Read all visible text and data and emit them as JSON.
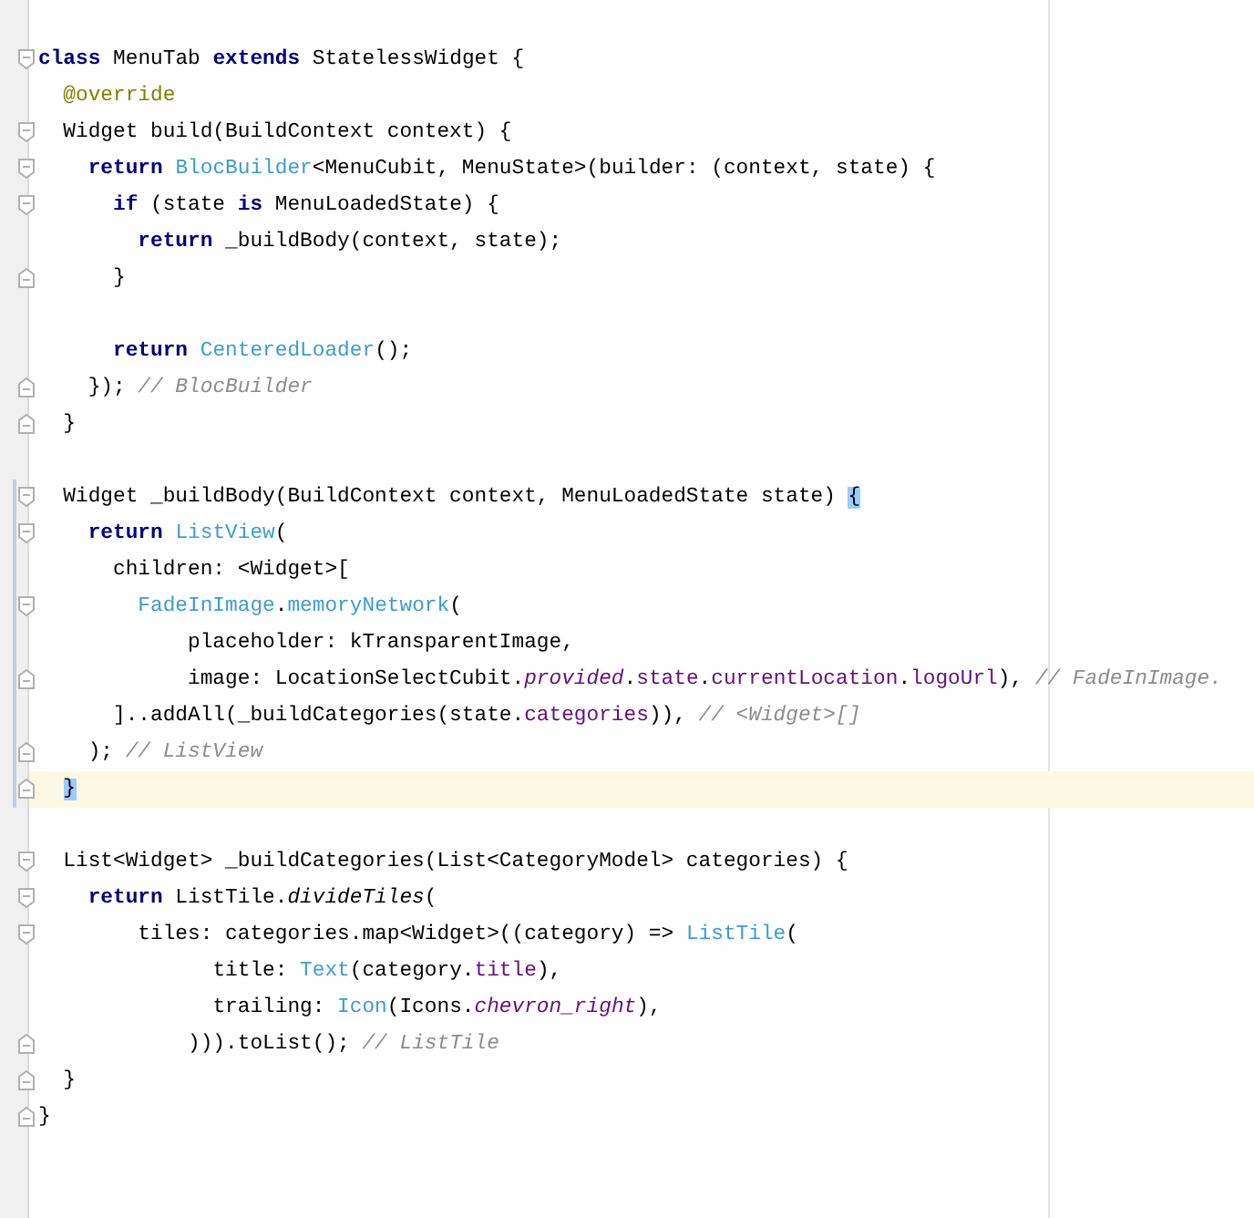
{
  "editor": {
    "lines": [
      {
        "fold_start": true,
        "fold_end": false,
        "changed": false,
        "current": false,
        "tokens": [
          {
            "text": "class",
            "kind": "keyword"
          },
          {
            "text": " MenuTab ",
            "kind": "plain"
          },
          {
            "text": "extends",
            "kind": "keyword"
          },
          {
            "text": " StatelessWidget {",
            "kind": "plain"
          }
        ]
      },
      {
        "fold_start": false,
        "fold_end": false,
        "changed": false,
        "current": false,
        "tokens": [
          {
            "text": "  @override",
            "kind": "annotation"
          }
        ]
      },
      {
        "fold_start": true,
        "fold_end": false,
        "changed": false,
        "current": false,
        "tokens": [
          {
            "text": "  Widget build(BuildContext context) {",
            "kind": "plain"
          }
        ]
      },
      {
        "fold_start": true,
        "fold_end": false,
        "changed": false,
        "current": false,
        "tokens": [
          {
            "text": "    return ",
            "kind": "keyword"
          },
          {
            "text": "BlocBuilder",
            "kind": "class"
          },
          {
            "text": "<MenuCubit, MenuState>(builder: (context, state) {",
            "kind": "plain"
          }
        ]
      },
      {
        "fold_start": true,
        "fold_end": false,
        "changed": false,
        "current": false,
        "tokens": [
          {
            "text": "      if",
            "kind": "keyword"
          },
          {
            "text": " (state ",
            "kind": "plain"
          },
          {
            "text": "is",
            "kind": "keyword"
          },
          {
            "text": " MenuLoadedState) {",
            "kind": "plain"
          }
        ]
      },
      {
        "fold_start": false,
        "fold_end": false,
        "changed": false,
        "current": false,
        "tokens": [
          {
            "text": "        return",
            "kind": "keyword"
          },
          {
            "text": " _buildBody(context, state);",
            "kind": "plain"
          }
        ]
      },
      {
        "fold_start": false,
        "fold_end": true,
        "changed": false,
        "current": false,
        "tokens": [
          {
            "text": "      }",
            "kind": "plain"
          }
        ]
      },
      {
        "blank": true
      },
      {
        "fold_start": false,
        "fold_end": false,
        "changed": false,
        "current": false,
        "tokens": [
          {
            "text": "      return ",
            "kind": "keyword"
          },
          {
            "text": "CenteredLoader",
            "kind": "class"
          },
          {
            "text": "();",
            "kind": "plain"
          }
        ]
      },
      {
        "fold_start": false,
        "fold_end": true,
        "changed": false,
        "current": false,
        "tokens": [
          {
            "text": "    });",
            "kind": "plain"
          },
          {
            "text": " // BlocBuilder",
            "kind": "comment"
          }
        ]
      },
      {
        "fold_start": false,
        "fold_end": true,
        "changed": false,
        "current": false,
        "tokens": [
          {
            "text": "  }",
            "kind": "plain"
          }
        ]
      },
      {
        "blank": true
      },
      {
        "fold_start": true,
        "fold_end": false,
        "changed": true,
        "current": false,
        "tokens": [
          {
            "text": "  Widget _buildBody(BuildContext context, MenuLoadedState state) ",
            "kind": "plain"
          },
          {
            "text": "{",
            "kind": "match"
          }
        ]
      },
      {
        "fold_start": true,
        "fold_end": false,
        "changed": true,
        "current": false,
        "tokens": [
          {
            "text": "    return ",
            "kind": "keyword"
          },
          {
            "text": "ListView",
            "kind": "class"
          },
          {
            "text": "(",
            "kind": "plain"
          }
        ]
      },
      {
        "fold_start": false,
        "fold_end": false,
        "changed": true,
        "current": false,
        "tokens": [
          {
            "text": "      children: <Widget>[",
            "kind": "plain"
          }
        ]
      },
      {
        "fold_start": true,
        "fold_end": false,
        "changed": true,
        "current": false,
        "tokens": [
          {
            "text": "        FadeInImage",
            "kind": "class"
          },
          {
            "text": ".",
            "kind": "plain"
          },
          {
            "text": "memoryNetwork",
            "kind": "class"
          },
          {
            "text": "(",
            "kind": "plain"
          }
        ]
      },
      {
        "fold_start": false,
        "fold_end": false,
        "changed": true,
        "current": false,
        "tokens": [
          {
            "text": "            placeholder: kTransparentImage,",
            "kind": "plain"
          }
        ]
      },
      {
        "fold_start": false,
        "fold_end": true,
        "changed": true,
        "current": false,
        "tokens": [
          {
            "text": "            image: LocationSelectCubit.",
            "kind": "plain"
          },
          {
            "text": "provided",
            "kind": "italic_field"
          },
          {
            "text": ".",
            "kind": "plain"
          },
          {
            "text": "state",
            "kind": "field"
          },
          {
            "text": ".",
            "kind": "plain"
          },
          {
            "text": "currentLocation",
            "kind": "field"
          },
          {
            "text": ".",
            "kind": "plain"
          },
          {
            "text": "logoUrl",
            "kind": "field"
          },
          {
            "text": "),",
            "kind": "plain"
          },
          {
            "text": " // FadeInImage.",
            "kind": "comment"
          }
        ]
      },
      {
        "fold_start": false,
        "fold_end": false,
        "changed": true,
        "current": false,
        "tokens": [
          {
            "text": "      ]..addAll(_buildCategories(state.",
            "kind": "plain"
          },
          {
            "text": "categories",
            "kind": "field"
          },
          {
            "text": ")),",
            "kind": "plain"
          },
          {
            "text": " // <Widget>[]",
            "kind": "comment"
          }
        ]
      },
      {
        "fold_start": false,
        "fold_end": true,
        "changed": true,
        "current": false,
        "tokens": [
          {
            "text": "    );",
            "kind": "plain"
          },
          {
            "text": " // ListView",
            "kind": "comment"
          }
        ]
      },
      {
        "fold_start": false,
        "fold_end": true,
        "changed": true,
        "current": true,
        "tokens": [
          {
            "text": "  }",
            "kind": "match"
          }
        ]
      },
      {
        "blank": true
      },
      {
        "fold_start": true,
        "fold_end": false,
        "changed": false,
        "current": false,
        "tokens": [
          {
            "text": "  List<Widget> _buildCategories(List<CategoryModel> categories) {",
            "kind": "plain"
          }
        ]
      },
      {
        "fold_start": true,
        "fold_end": false,
        "changed": false,
        "current": false,
        "tokens": [
          {
            "text": "    return",
            "kind": "keyword"
          },
          {
            "text": " ListTile.",
            "kind": "plain"
          },
          {
            "text": "divideTiles",
            "kind": "italic"
          },
          {
            "text": "(",
            "kind": "plain"
          }
        ]
      },
      {
        "fold_start": true,
        "fold_end": false,
        "changed": false,
        "current": false,
        "tokens": [
          {
            "text": "        tiles: categories.map<Widget>((category) => ",
            "kind": "plain"
          },
          {
            "text": "ListTile",
            "kind": "class"
          },
          {
            "text": "(",
            "kind": "plain"
          }
        ]
      },
      {
        "fold_start": false,
        "fold_end": false,
        "changed": false,
        "current": false,
        "tokens": [
          {
            "text": "              title: ",
            "kind": "plain"
          },
          {
            "text": "Text",
            "kind": "class"
          },
          {
            "text": "(category.",
            "kind": "plain"
          },
          {
            "text": "title",
            "kind": "field"
          },
          {
            "text": "),",
            "kind": "plain"
          }
        ]
      },
      {
        "fold_start": false,
        "fold_end": false,
        "changed": false,
        "current": false,
        "tokens": [
          {
            "text": "              trailing: ",
            "kind": "plain"
          },
          {
            "text": "Icon",
            "kind": "class"
          },
          {
            "text": "(Icons.",
            "kind": "plain"
          },
          {
            "text": "chevron_right",
            "kind": "italic_field"
          },
          {
            "text": "),",
            "kind": "plain"
          }
        ]
      },
      {
        "fold_start": false,
        "fold_end": true,
        "changed": false,
        "current": false,
        "tokens": [
          {
            "text": "            ))).toList();",
            "kind": "plain"
          },
          {
            "text": " // ListTile",
            "kind": "comment"
          }
        ]
      },
      {
        "fold_start": false,
        "fold_end": true,
        "changed": false,
        "current": false,
        "tokens": [
          {
            "text": "  }",
            "kind": "plain"
          }
        ]
      },
      {
        "fold_start": false,
        "fold_end": true,
        "changed": false,
        "current": false,
        "tokens": [
          {
            "text": "}",
            "kind": "plain"
          }
        ]
      }
    ]
  }
}
